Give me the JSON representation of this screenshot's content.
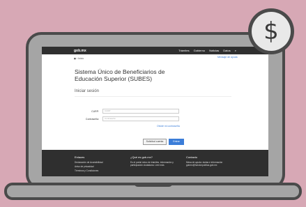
{
  "header": {
    "logo": "gob.mx",
    "nav": [
      "Trámites",
      "Gobierno",
      "Noticias",
      "Datos"
    ],
    "search_icon": "search-icon"
  },
  "page": {
    "breadcrumb": "◼ › Inicio",
    "top_link": "Mensaje de ayuda",
    "title": "Sistema Único de Beneficiarios de Educación Superior (SUBES)",
    "subtitle": "Iniciar sesión",
    "curp_label": "CURP:",
    "curp_placeholder": "CURP",
    "password_label": "Contraseña:",
    "password_placeholder": "Contraseña",
    "forgot_link": "Olvidé mi contraseña",
    "register_button": "Solicitud cuenta",
    "login_button": "Entrar"
  },
  "footer": {
    "col1_title": "Enlaces",
    "col1_items": [
      "Declaración de Accesibilidad",
      "Aviso de privacidad",
      "Términos y Condiciones"
    ],
    "col2_title": "¿Qué es gob.mx?",
    "col2_text": "Es el portal único de trámites, información y participación ciudadana. Leer más",
    "col3_title": "Contacto",
    "col3_text": "Mesa de ayuda: dudas e información gobmx@funcionpublica.gob.mx"
  },
  "coin_symbol": "$",
  "colors": {
    "background": "#d7a8b5",
    "laptop_frame": "#4a4a4a",
    "primary_button": "#3b7dd8"
  }
}
